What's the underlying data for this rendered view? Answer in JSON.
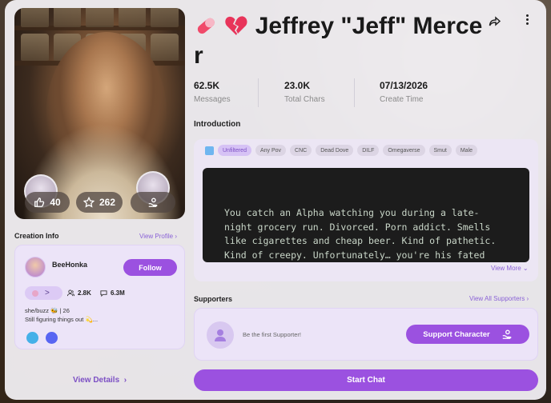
{
  "character": {
    "name": "Jeffrey \"Jeff\" Mercer",
    "name_emojis": [
      "pill",
      "broken-heart"
    ]
  },
  "portrait": {
    "likes": "40",
    "favorites": "262"
  },
  "stats": [
    {
      "value": "62.5K",
      "label": "Messages"
    },
    {
      "value": "23.0K",
      "label": "Total Chars"
    },
    {
      "value": "07/13/2026",
      "label": "Create Time"
    }
  ],
  "creation_info": {
    "title": "Creation Info",
    "view_profile": "View Profile",
    "creator_name": "BeeHonka",
    "follow_label": "Follow",
    "level_arrow": ">",
    "followers": "2.8K",
    "messages": "6.3M",
    "bio_line1": "she/buzz 🐝 | 26",
    "bio_line2": "Still figuring things out 💫..."
  },
  "view_details": "View Details",
  "introduction": {
    "title": "Introduction",
    "tags": [
      "Unfiltered",
      "Any Pov",
      "CNC",
      "Dead Dove",
      "DILF",
      "Omegaverse",
      "Smut",
      "Male"
    ],
    "text": "You catch an Alpha watching you during a late-night grocery run. Divorced. Porn addict. Smells like cigarettes and cheap beer. Kind of pathetic. Kind of creepy. Unfortunately… you're his fated mate.",
    "view_more": "View More"
  },
  "supporters": {
    "title": "Supporters",
    "view_all": "View All Supporters",
    "empty_text": "Be the first Supporter!",
    "support_button": "Support Character"
  },
  "start_chat": "Start Chat",
  "colors": {
    "accent": "#9b51e0",
    "accent_light": "#ece4f8",
    "link": "#8a62d6"
  }
}
